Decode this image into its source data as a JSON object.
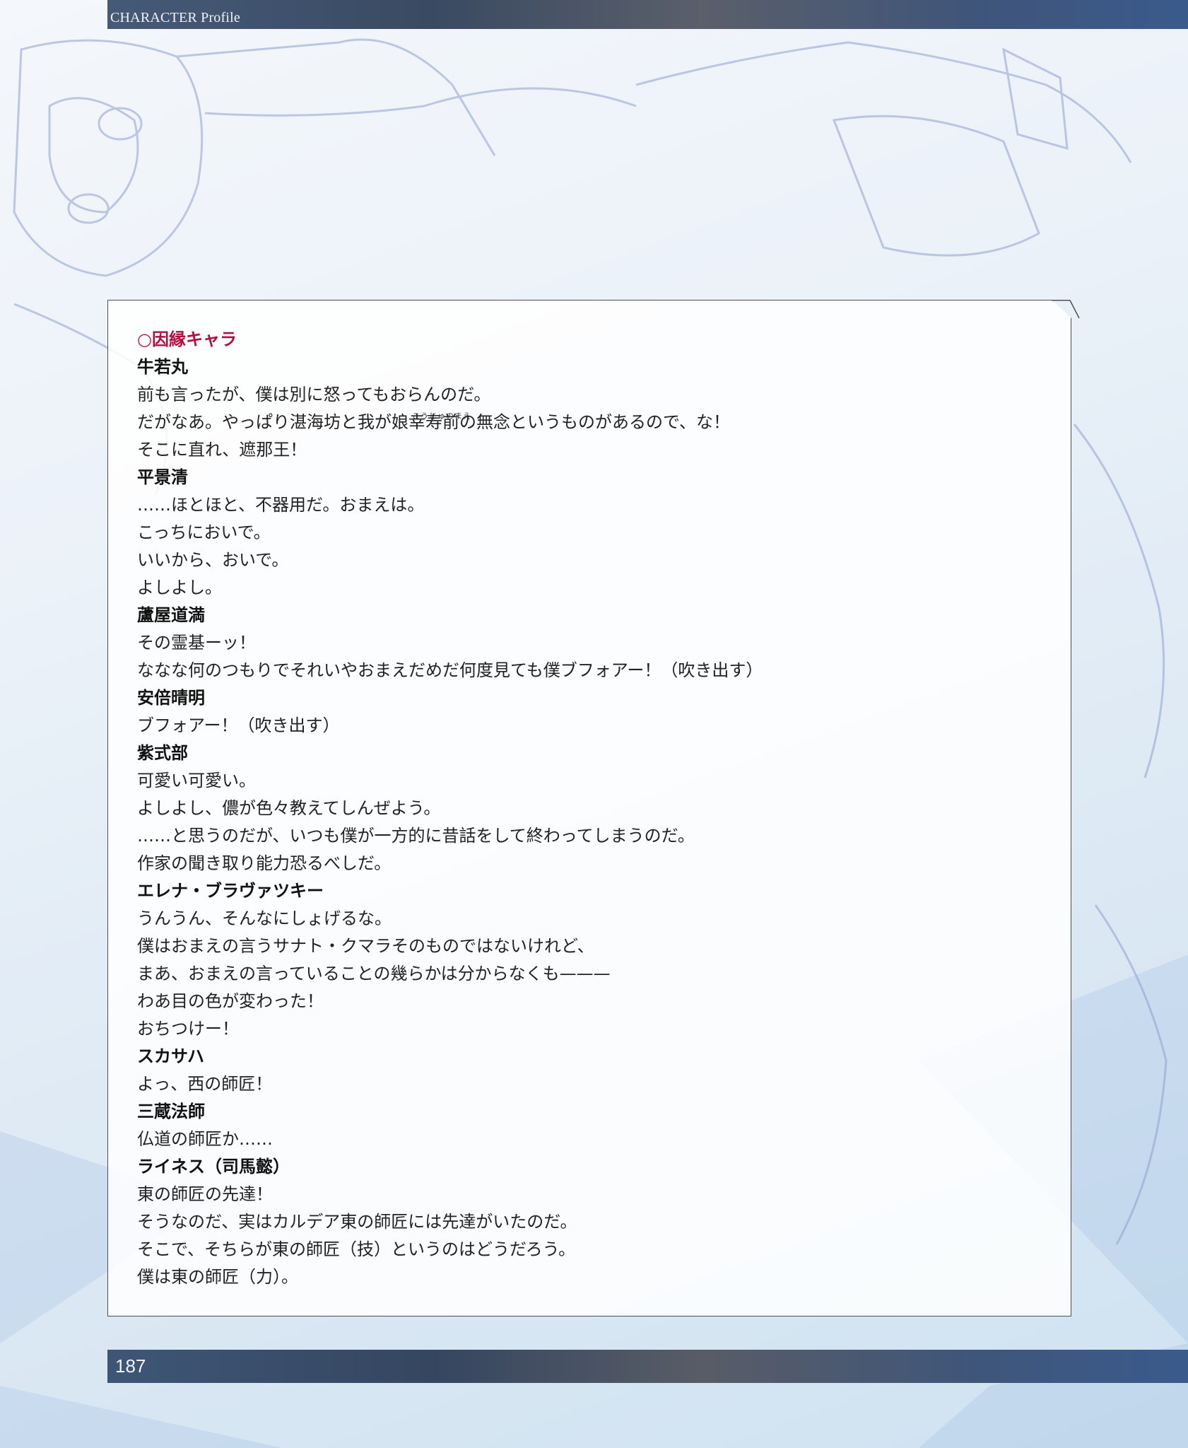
{
  "header": {
    "title": "CHARACTER Profile"
  },
  "panel": {
    "heading": "○因縁キャラ",
    "ruby": "こうじゅのまえ",
    "lines": [
      {
        "kind": "name",
        "text": "牛若丸"
      },
      {
        "kind": "text",
        "text": "前も言ったが、僕は別に怒ってもおらんのだ。"
      },
      {
        "kind": "text",
        "text": "だがなあ。やっぱり湛海坊と我が娘幸寿前の無念というものがあるので、な！"
      },
      {
        "kind": "text",
        "text": "そこに直れ、遮那王！"
      },
      {
        "kind": "name",
        "text": "平景清"
      },
      {
        "kind": "text",
        "text": "……ほとほと、不器用だ。おまえは。"
      },
      {
        "kind": "text",
        "text": "こっちにおいで。"
      },
      {
        "kind": "text",
        "text": "いいから、おいで。"
      },
      {
        "kind": "text",
        "text": "よしよし。"
      },
      {
        "kind": "name",
        "text": "蘆屋道満"
      },
      {
        "kind": "text",
        "text": "その霊基ーッ！"
      },
      {
        "kind": "text",
        "text": "ななな何のつもりでそれいやおまえだめだ何度見ても僕ブフォアー！（吹き出す）"
      },
      {
        "kind": "name",
        "text": "安倍晴明"
      },
      {
        "kind": "text",
        "text": "ブフォアー！（吹き出す）"
      },
      {
        "kind": "name",
        "text": "紫式部"
      },
      {
        "kind": "text",
        "text": "可愛い可愛い。"
      },
      {
        "kind": "text",
        "text": "よしよし、儂が色々教えてしんぜよう。"
      },
      {
        "kind": "text",
        "text": "……と思うのだが、いつも僕が一方的に昔話をして終わってしまうのだ。"
      },
      {
        "kind": "text",
        "text": "作家の聞き取り能力恐るべしだ。"
      },
      {
        "kind": "name",
        "text": "エレナ・ブラヴァツキー"
      },
      {
        "kind": "text",
        "text": "うんうん、そんなにしょげるな。"
      },
      {
        "kind": "text",
        "text": "僕はおまえの言うサナト・クマラそのものではないけれど、"
      },
      {
        "kind": "text",
        "text": "まあ、おまえの言っていることの幾らかは分からなくも———"
      },
      {
        "kind": "text",
        "text": "わあ目の色が変わった！"
      },
      {
        "kind": "text",
        "text": "おちつけー！"
      },
      {
        "kind": "name",
        "text": "スカサハ"
      },
      {
        "kind": "text",
        "text": "よっ、西の師匠！"
      },
      {
        "kind": "name",
        "text": "三蔵法師"
      },
      {
        "kind": "text",
        "text": "仏道の師匠か……"
      },
      {
        "kind": "name",
        "text": "ライネス（司馬懿）"
      },
      {
        "kind": "text",
        "text": "東の師匠の先達！"
      },
      {
        "kind": "text",
        "text": "そうなのだ、実はカルデア東の師匠には先達がいたのだ。"
      },
      {
        "kind": "text",
        "text": "そこで、そちらが東の師匠（技）というのはどうだろう。"
      },
      {
        "kind": "text",
        "text": "僕は東の師匠（力）。"
      }
    ]
  },
  "footer": {
    "page_number": "187"
  },
  "colors": {
    "accent": "#b0103f",
    "bar": "#3a4a62"
  }
}
